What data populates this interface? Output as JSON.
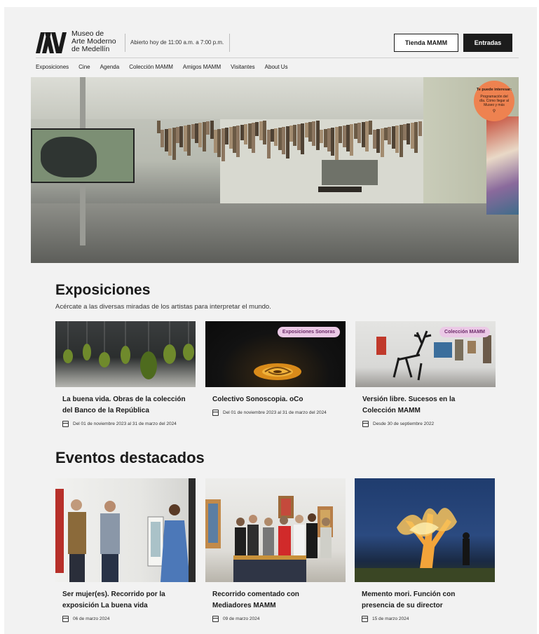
{
  "header": {
    "logo_lines": [
      "Museo de",
      "Arte Moderno",
      "de Medellín"
    ],
    "hours": "Abierto hoy de 11:00 a.m. a 7:00 p.m.",
    "shop_label": "Tienda MAMM",
    "tickets_label": "Entradas"
  },
  "nav": [
    "Exposiciones",
    "Cine",
    "Agenda",
    "Colección MAMM",
    "Amigos MAMM",
    "Visitantes",
    "About Us"
  ],
  "promo": {
    "title": "Te puede interesar:",
    "text": "Programación del día. Cómo llegar al Museo y más",
    "icon": "search-icon"
  },
  "exhibitions": {
    "title": "Exposiciones",
    "subtitle": "Acércate a las diversas miradas de los artistas para interpretar el mundo.",
    "items": [
      {
        "title": "La buena vida. Obras de la colección del Banco de la República",
        "date": "Del 01 de noviembre 2023 al 31 de marzo del 2024",
        "tag": ""
      },
      {
        "title": "Colectivo Sonoscopia. oCo",
        "date": "Del 01 de noviembre 2023 al 31 de marzo del 2024",
        "tag": "Exposiciones Sonoras"
      },
      {
        "title": "Versión libre. Sucesos en la Colección MAMM",
        "date": "Desde 30 de septiembre 2022",
        "tag": "Colección MAMM"
      }
    ]
  },
  "events": {
    "title": "Eventos destacados",
    "items": [
      {
        "title": "Ser mujer(es). Recorrido por la exposición La buena vida",
        "date": "06 de marzo 2024"
      },
      {
        "title": "Recorrido comentado con Mediadores MAMM",
        "date": "09 de marzo 2024"
      },
      {
        "title": "Memento mori. Función con presencia de su director",
        "date": "15 de marzo 2024"
      }
    ]
  }
}
